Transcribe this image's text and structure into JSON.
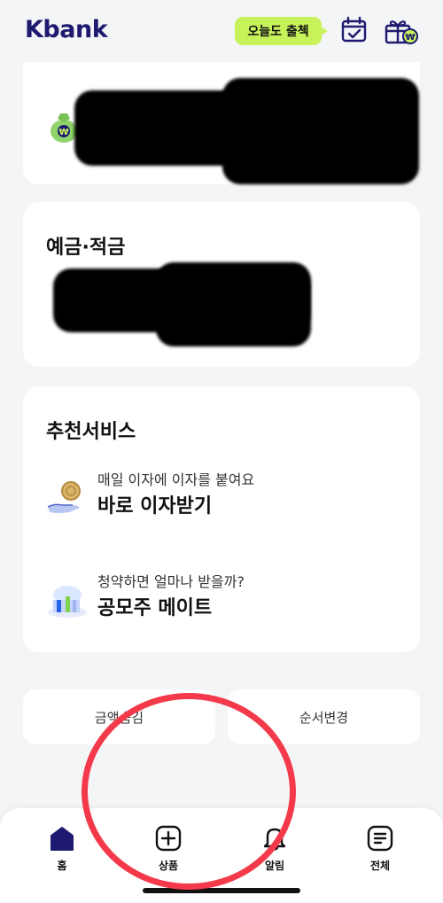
{
  "header": {
    "logo": "Kbank",
    "attendance_label": "오늘도 출첵"
  },
  "cards": {
    "savings_title_partial": "",
    "deposit_title": "예금·적금"
  },
  "recommend": {
    "title": "추천서비스",
    "items": [
      {
        "sub": "매일 이자에 이자를 붙여요",
        "main": "바로 이자받기",
        "icon": "coin-hand-icon"
      },
      {
        "sub": "청약하면 얼마나 받을까?",
        "main": "공모주 메이트",
        "icon": "building-icon"
      }
    ]
  },
  "actions": {
    "hide_amount": "금액숨김",
    "reorder": "순서변경"
  },
  "tabs": [
    {
      "label": "홈",
      "icon": "home-icon"
    },
    {
      "label": "상품",
      "icon": "plus-square-icon"
    },
    {
      "label": "알림",
      "icon": "bell-icon"
    },
    {
      "label": "전체",
      "icon": "menu-list-icon"
    }
  ],
  "colors": {
    "brand": "#1d1a6f",
    "accent": "#c8f25a",
    "annotation": "#f43a4a"
  }
}
